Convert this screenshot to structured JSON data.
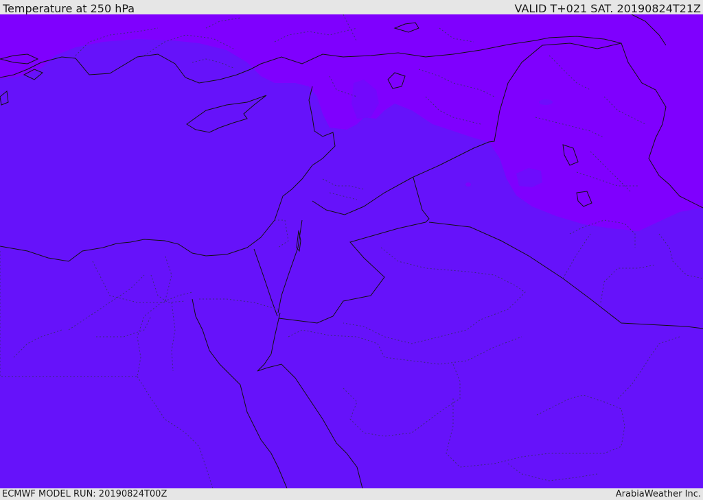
{
  "header": {
    "title": "Temperature at 250 hPa",
    "valid_time": "VALID T+021 SAT. 20190824T21Z"
  },
  "footer": {
    "model_run": "ECMWF MODEL RUN: 20190824T00Z",
    "credit": "ArabiaWeather Inc."
  },
  "map": {
    "colors": {
      "field_main": "#6612fa",
      "field_cold": "#7f00fe",
      "field_mid": "#7208fc",
      "country_border": "#111111",
      "admin_border": "#3a2a7a"
    }
  }
}
